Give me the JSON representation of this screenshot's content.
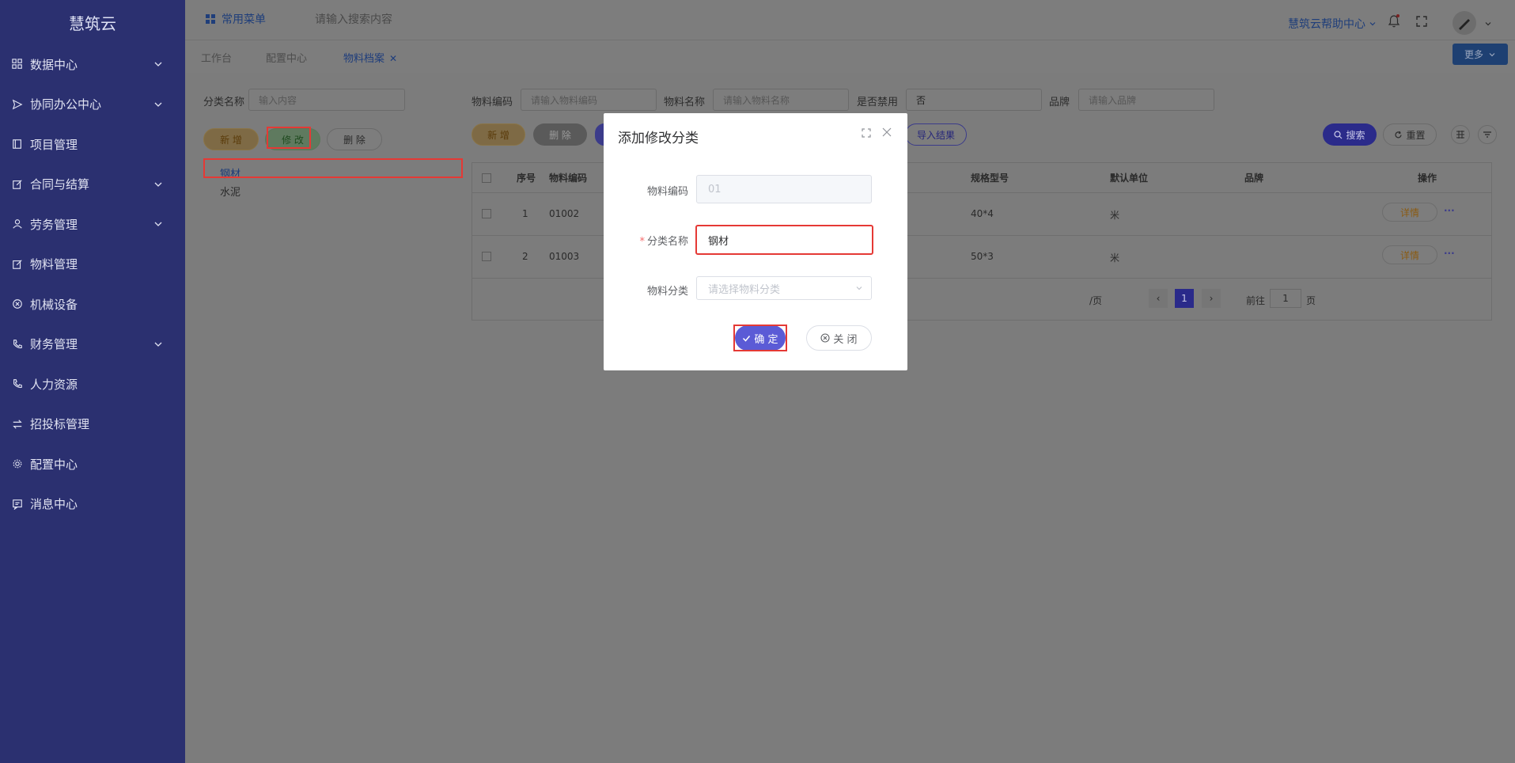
{
  "app": {
    "brand": "慧筑云"
  },
  "sidebar": {
    "items": [
      {
        "label": "数据中心",
        "icon": "grid-icon",
        "expandable": true
      },
      {
        "label": "协同办公中心",
        "icon": "send-icon",
        "expandable": true
      },
      {
        "label": "项目管理",
        "icon": "book-icon",
        "expandable": false
      },
      {
        "label": "合同与结算",
        "icon": "edit-icon",
        "expandable": true
      },
      {
        "label": "劳务管理",
        "icon": "user-icon",
        "expandable": true
      },
      {
        "label": "物料管理",
        "icon": "edit-icon",
        "expandable": false
      },
      {
        "label": "机械设备",
        "icon": "circle-x-icon",
        "expandable": false
      },
      {
        "label": "财务管理",
        "icon": "phone-icon",
        "expandable": true
      },
      {
        "label": "人力资源",
        "icon": "phone-icon",
        "expandable": false
      },
      {
        "label": "招投标管理",
        "icon": "swap-icon",
        "expandable": false
      },
      {
        "label": "配置中心",
        "icon": "gear-icon",
        "expandable": false
      },
      {
        "label": "消息中心",
        "icon": "message-icon",
        "expandable": false
      }
    ]
  },
  "topbar": {
    "menu_label": "常用菜单",
    "search_placeholder": "请输入搜索内容",
    "help_label": "慧筑云帮助中心"
  },
  "tabs": [
    {
      "label": "工作台",
      "active": false
    },
    {
      "label": "配置中心",
      "active": false
    },
    {
      "label": "物料档案",
      "active": true,
      "closable": true
    }
  ],
  "more_label": "更多",
  "left_panel": {
    "category_label": "分类名称",
    "category_placeholder": "输入内容",
    "add_label": "新 增",
    "edit_label": "修 改",
    "delete_label": "删 除",
    "tree": [
      "钢材",
      "水泥"
    ]
  },
  "filters": {
    "code_label": "物料编码",
    "code_placeholder": "请输入物料编码",
    "name_label": "物料名称",
    "name_placeholder": "请输入物料名称",
    "disabled_label": "是否禁用",
    "disabled_value": "否",
    "brand_label": "品牌",
    "brand_placeholder": "请输入品牌"
  },
  "toolbar": {
    "add_label": "新 增",
    "delete_label": "删 除",
    "import_result_label": "导入结果",
    "search_label": "搜索",
    "reset_label": "重置"
  },
  "table": {
    "headers": {
      "index": "序号",
      "code": "物料编码",
      "spec": "规格型号",
      "unit": "默认单位",
      "brand": "品牌",
      "action": "操作"
    },
    "rows": [
      {
        "index": "1",
        "code": "01002",
        "spec": "40*4",
        "unit": "米",
        "brand": "",
        "action": "详情"
      },
      {
        "index": "2",
        "code": "01003",
        "spec": "50*3",
        "unit": "米",
        "brand": "",
        "action": "详情"
      }
    ]
  },
  "pagination": {
    "page_size_suffix": "/页",
    "current_page": "1",
    "goto_label": "前往",
    "goto_value": "1",
    "page_suffix": "页"
  },
  "modal": {
    "title": "添加修改分类",
    "code_label": "物料编码",
    "code_value": "01",
    "name_label": "分类名称",
    "name_required": "*",
    "name_value": "钢材",
    "parent_label": "物料分类",
    "parent_placeholder": "请选择物料分类",
    "confirm_label": "确 定",
    "close_label": "关 闭"
  },
  "colors": {
    "sidebar_bg": "#2b3070",
    "primary": "#5b5bd6",
    "highlight": "#e53935"
  }
}
